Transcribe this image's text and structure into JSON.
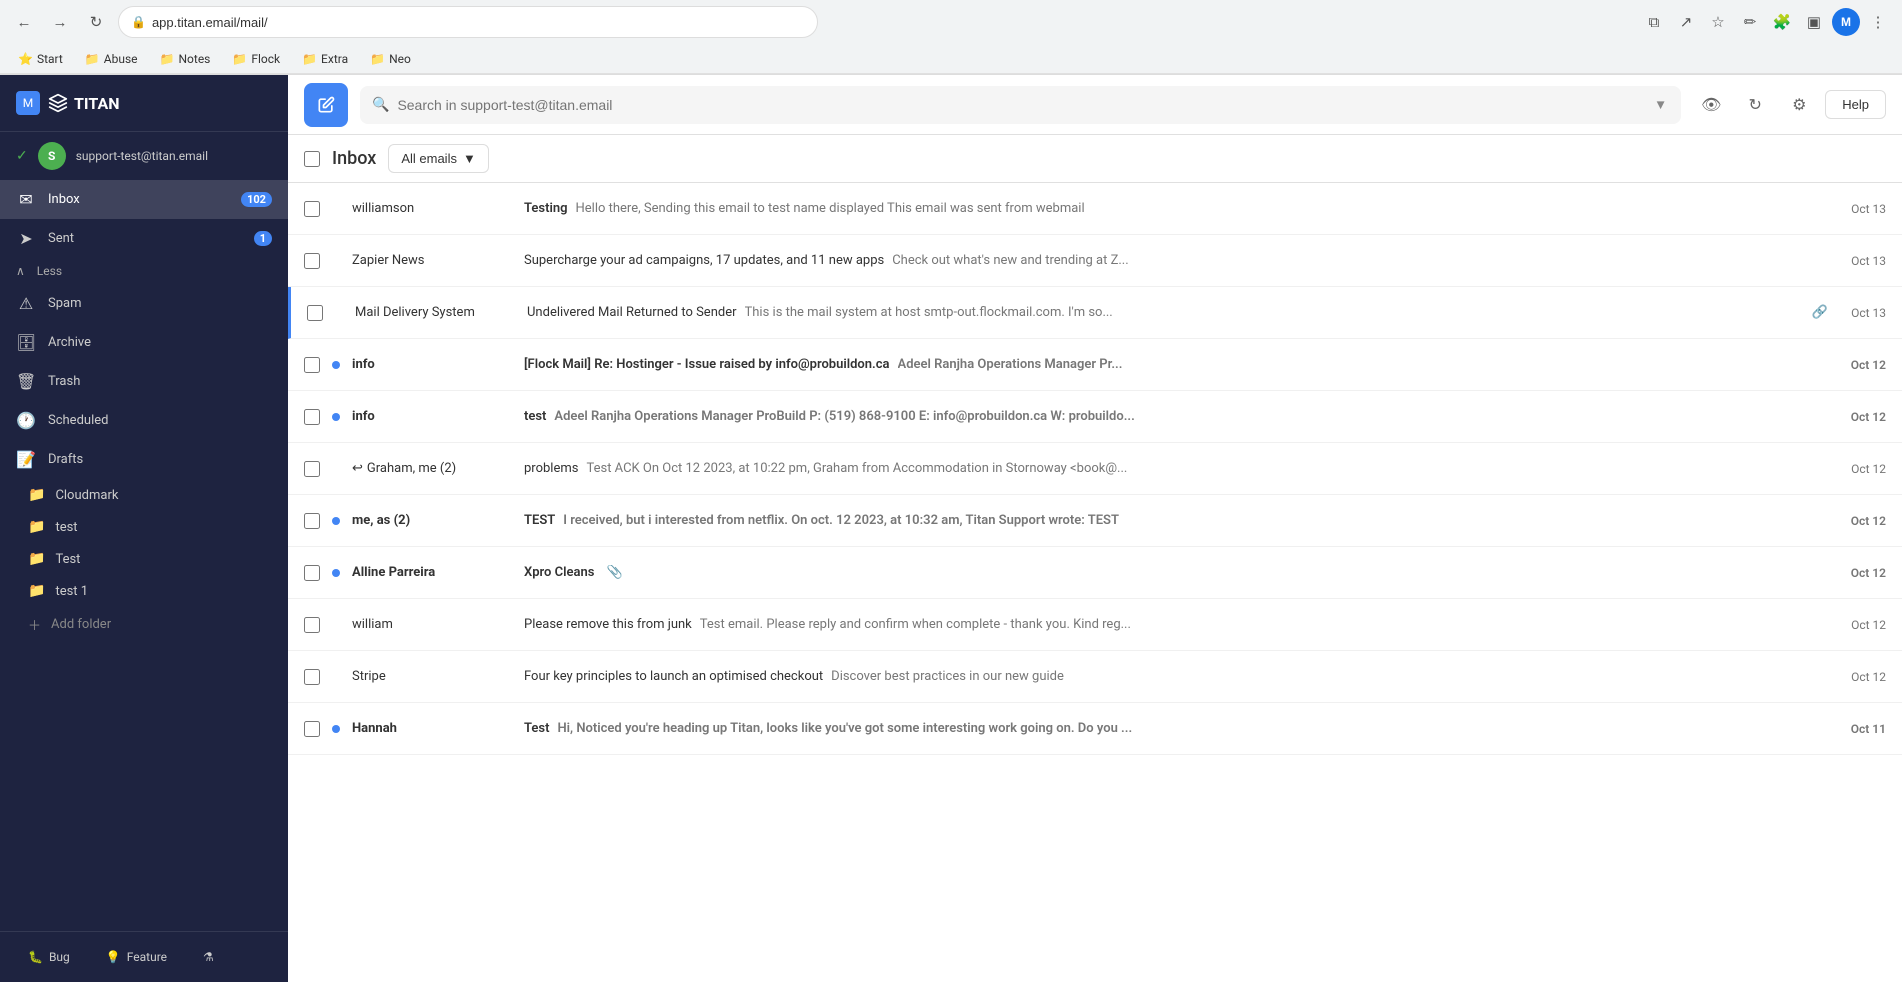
{
  "browser": {
    "url": "app.titan.email/mail/",
    "nav_back": "←",
    "nav_forward": "→",
    "nav_refresh": "↻",
    "bookmarks": [
      {
        "label": "Start",
        "icon": "⭐"
      },
      {
        "label": "Abuse",
        "icon": "📁"
      },
      {
        "label": "Notes",
        "icon": "📁"
      },
      {
        "label": "Flock",
        "icon": "📁"
      },
      {
        "label": "Extra",
        "icon": "📁"
      },
      {
        "label": "Neo",
        "icon": "📁"
      }
    ]
  },
  "sidebar": {
    "logo": "TITAN",
    "account_email": "support-test@titan.email",
    "account_initial": "S",
    "nav_items": [
      {
        "id": "inbox",
        "icon": "✉",
        "label": "Inbox",
        "badge": "102"
      },
      {
        "id": "sent",
        "icon": "➤",
        "label": "Sent",
        "badge": "1"
      },
      {
        "id": "less",
        "icon": "∧",
        "label": "Less",
        "badge": ""
      },
      {
        "id": "spam",
        "icon": "⚠",
        "label": "Spam",
        "badge": ""
      },
      {
        "id": "archive",
        "icon": "🗄",
        "label": "Archive",
        "badge": ""
      },
      {
        "id": "trash",
        "icon": "🗑",
        "label": "Trash",
        "badge": ""
      },
      {
        "id": "scheduled",
        "icon": "🕐",
        "label": "Scheduled",
        "badge": ""
      },
      {
        "id": "drafts",
        "icon": "📝",
        "label": "Drafts",
        "badge": ""
      }
    ],
    "folders": [
      {
        "label": "Cloudmark"
      },
      {
        "label": "test"
      },
      {
        "label": "Test"
      },
      {
        "label": "test 1"
      }
    ],
    "add_folder_label": "Add folder",
    "footer_items": [
      {
        "label": "Bug",
        "icon": "🐛"
      },
      {
        "label": "Feature",
        "icon": "💡"
      },
      {
        "label": "⚗",
        "icon": "⚗"
      }
    ]
  },
  "topbar": {
    "search_placeholder": "Search in support-test@titan.email",
    "help_label": "Help"
  },
  "email_list": {
    "inbox_label": "Inbox",
    "filter_label": "All emails",
    "emails": [
      {
        "sender": "williamson",
        "sender_bold": false,
        "unread": false,
        "subject": "Testing",
        "subject_bold": true,
        "preview": "Hello there, Sending this email to test name displayed This email was sent from webmail",
        "date": "Oct 13",
        "has_attachment": false,
        "has_reply_icon": false,
        "has_unread_dot": false,
        "blue_border": false
      },
      {
        "sender": "Zapier News",
        "sender_bold": false,
        "unread": false,
        "subject": "Supercharge your ad campaigns, 17 updates, and 11 new apps",
        "subject_bold": false,
        "preview": "Check out what's new and trending at Z...",
        "date": "Oct 13",
        "has_attachment": false,
        "has_reply_icon": false,
        "has_unread_dot": false,
        "blue_border": false
      },
      {
        "sender": "Mail Delivery System",
        "sender_bold": false,
        "unread": false,
        "subject": "Undelivered Mail Returned to Sender",
        "subject_bold": false,
        "preview": "This is the mail system at host smtp-out.flockmail.com. I'm so...",
        "date": "Oct 13",
        "has_attachment": true,
        "has_reply_icon": false,
        "has_unread_dot": false,
        "blue_border": true
      },
      {
        "sender": "info",
        "sender_bold": true,
        "unread": true,
        "subject": "[Flock Mail] Re: Hostinger - Issue raised by info@probuildon.ca",
        "subject_bold": true,
        "preview": "Adeel Ranjha Operations Manager Pr...",
        "date": "Oct 12",
        "has_attachment": false,
        "has_reply_icon": false,
        "has_unread_dot": true,
        "blue_border": false
      },
      {
        "sender": "info",
        "sender_bold": true,
        "unread": true,
        "subject": "test",
        "subject_bold": true,
        "preview": "Adeel Ranjha Operations Manager ProBuild P: (519) 868-9100 E: info@probuildon.ca W: probuildo...",
        "date": "Oct 12",
        "has_attachment": false,
        "has_reply_icon": false,
        "has_unread_dot": true,
        "blue_border": false
      },
      {
        "sender": "Graham, me (2)",
        "sender_bold": false,
        "unread": false,
        "subject": "problems",
        "subject_bold": false,
        "preview": "Test ACK On Oct 12 2023, at 10:22 pm, Graham from Accommodation in Stornoway <book@...",
        "date": "Oct 12",
        "has_attachment": false,
        "has_reply_icon": true,
        "has_unread_dot": false,
        "blue_border": false
      },
      {
        "sender": "me, as (2)",
        "sender_bold": true,
        "unread": true,
        "subject": "TEST",
        "subject_bold": true,
        "preview": "I received, but i interested from netflix. On oct. 12 2023, at 10:32 am, Titan Support wrote: TEST",
        "date": "Oct 12",
        "has_attachment": false,
        "has_reply_icon": false,
        "has_unread_dot": true,
        "blue_border": false
      },
      {
        "sender": "Alline Parreira",
        "sender_bold": true,
        "unread": true,
        "subject": "Xpro Cleans",
        "subject_bold": true,
        "preview": "",
        "date": "Oct 12",
        "has_attachment": true,
        "has_reply_icon": false,
        "has_unread_dot": true,
        "blue_border": false
      },
      {
        "sender": "william",
        "sender_bold": false,
        "unread": false,
        "subject": "Please remove this from junk",
        "subject_bold": false,
        "preview": "Test email. Please reply and confirm when complete - thank you. Kind reg...",
        "date": "Oct 12",
        "has_attachment": false,
        "has_reply_icon": false,
        "has_unread_dot": false,
        "blue_border": false
      },
      {
        "sender": "Stripe",
        "sender_bold": false,
        "unread": false,
        "subject": "Four key principles to launch an optimised checkout",
        "subject_bold": false,
        "preview": "Discover best practices in our new guide",
        "date": "Oct 12",
        "has_attachment": false,
        "has_reply_icon": false,
        "has_unread_dot": false,
        "blue_border": false
      },
      {
        "sender": "Hannah",
        "sender_bold": true,
        "unread": true,
        "subject": "Test",
        "subject_bold": true,
        "preview": "Hi, Noticed you're heading up Titan, looks like you've got some interesting work going on. Do you ...",
        "date": "Oct 11",
        "has_attachment": false,
        "has_reply_icon": false,
        "has_unread_dot": true,
        "blue_border": false
      }
    ]
  }
}
